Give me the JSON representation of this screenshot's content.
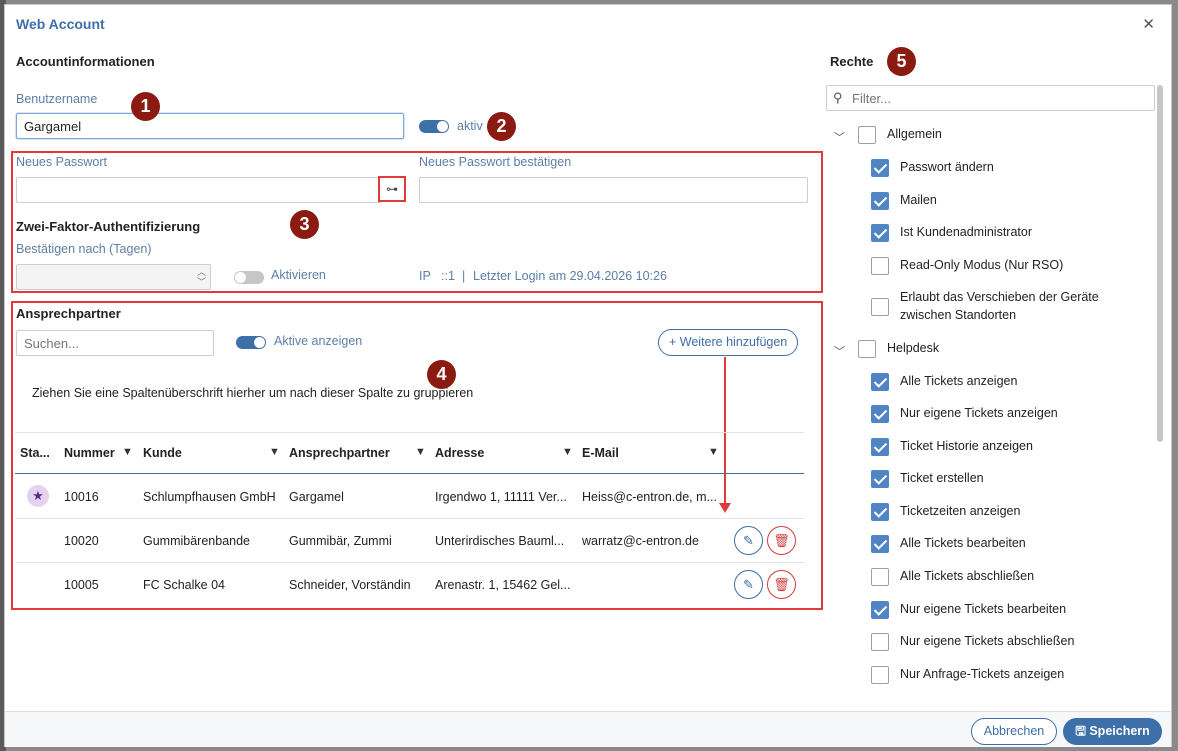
{
  "dialog": {
    "title": "Web Account"
  },
  "account": {
    "heading": "Accountinformationen",
    "username_label": "Benutzername",
    "username_value": "Gargamel",
    "active_label": "aktiv",
    "new_password_label": "Neues Passwort",
    "confirm_password_label": "Neues Passwort bestätigen",
    "twofa_heading": "Zwei-Faktor-Authentifizierung",
    "confirm_days_label": "Bestätigen nach (Tagen)",
    "activate_label": "Aktivieren",
    "ip_label": "IP",
    "ip_value": "::1",
    "separator": "|",
    "last_login": "Letzter Login am 29.04.2026 10:26"
  },
  "contacts": {
    "heading": "Ansprechpartner",
    "search_placeholder": "Suchen...",
    "show_active_label": "Aktive anzeigen",
    "add_more_label": "+ Weitere hinzufügen",
    "group_hint": "Ziehen Sie eine Spaltenüberschrift hierher um nach dieser Spalte zu gruppieren",
    "columns": [
      "Sta...",
      "Nummer",
      "Kunde",
      "Ansprechpartner",
      "Adresse",
      "E-Mail"
    ],
    "rows": [
      {
        "number": "10016",
        "customer": "Schlumpfhausen GmbH",
        "contact": "Gargamel",
        "address": "Irgendwo 1, 11111 Ver...",
        "email": "Heiss@c-entron.de, m..."
      },
      {
        "number": "10020",
        "customer": "Gummibärenbande",
        "contact": "Gummibär, Zummi",
        "address": "Unterirdisches Bauml...",
        "email": "warratz@c-entron.de"
      },
      {
        "number": "10005",
        "customer": "FC Schalke 04",
        "contact": "Schneider, Vorständin",
        "address": "Arenastr. 1, 15462 Gel...",
        "email": ""
      }
    ]
  },
  "rights": {
    "heading": "Rechte",
    "filter_placeholder": "Filter...",
    "groups": [
      {
        "label": "Allgemein",
        "items": [
          {
            "label": "Passwort ändern",
            "checked": true
          },
          {
            "label": "Mailen",
            "checked": true
          },
          {
            "label": "Ist Kundenadministrator",
            "checked": true
          },
          {
            "label": "Read-Only Modus (Nur RSO)",
            "checked": false
          },
          {
            "label": "Erlaubt das Verschieben der Geräte",
            "label2": "zwischen Standorten",
            "checked": false
          }
        ]
      },
      {
        "label": "Helpdesk",
        "items": [
          {
            "label": "Alle Tickets anzeigen",
            "checked": true
          },
          {
            "label": "Nur eigene Tickets anzeigen",
            "checked": true
          },
          {
            "label": "Ticket Historie anzeigen",
            "checked": true
          },
          {
            "label": "Ticket erstellen",
            "checked": true
          },
          {
            "label": "Ticketzeiten anzeigen",
            "checked": true
          },
          {
            "label": "Alle Tickets bearbeiten",
            "checked": true
          },
          {
            "label": "Alle Tickets abschließen",
            "checked": false
          },
          {
            "label": "Nur eigene Tickets bearbeiten",
            "checked": true
          },
          {
            "label": "Nur eigene Tickets abschließen",
            "checked": false
          },
          {
            "label": "Nur Anfrage-Tickets anzeigen",
            "checked": false
          }
        ]
      }
    ]
  },
  "badges": [
    "1",
    "2",
    "3",
    "4",
    "5"
  ],
  "footer": {
    "cancel_label": "Abbrechen",
    "save_label": "Speichern"
  },
  "icons": {
    "close": "close-icon",
    "key": "key-icon",
    "search": "search-icon",
    "star": "star-icon",
    "edit": "pencil-icon",
    "delete": "trash-icon",
    "filter": "filter-icon",
    "save": "floppy-icon",
    "chevron": "chevron-down-icon"
  },
  "colors": {
    "accent": "#3d6fa8",
    "annotation": "#e03a3a",
    "badge": "#8b1a10"
  }
}
